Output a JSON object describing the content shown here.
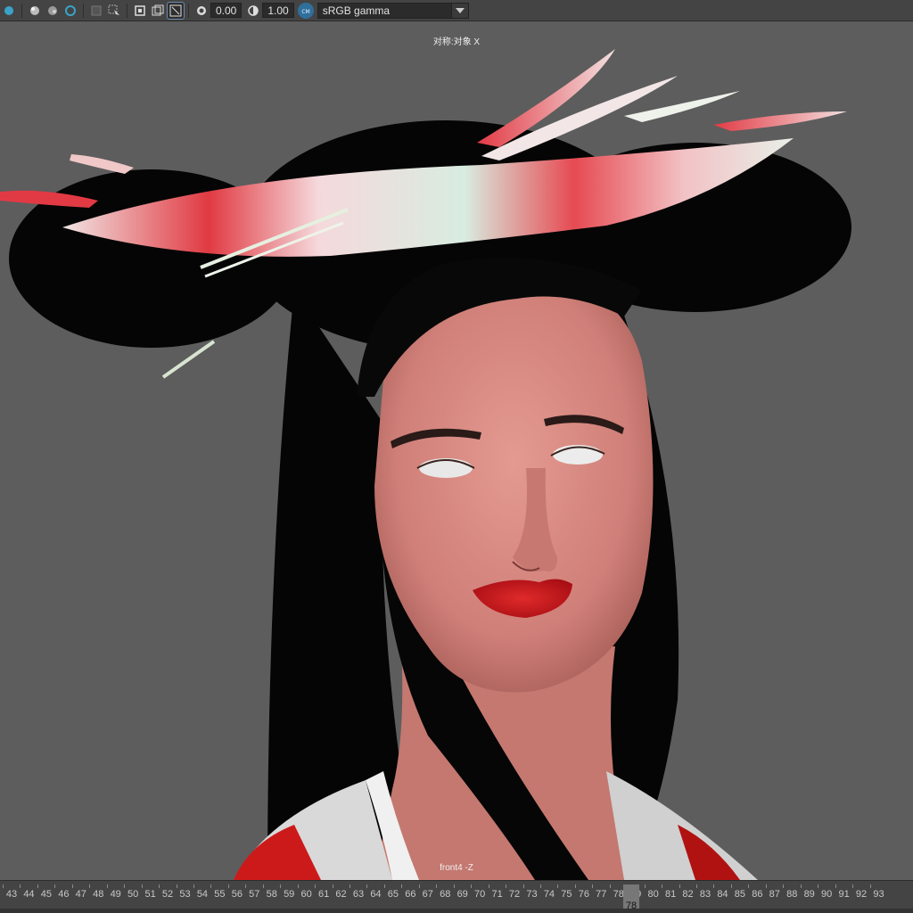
{
  "toolbar": {
    "exposure_value": "0.00",
    "gamma_value": "1.00",
    "color_management_badge": "CM",
    "view_transform": "sRGB gamma"
  },
  "viewport": {
    "symmetry_label": "对称:对象 X",
    "camera_label": "front4 -Z"
  },
  "timeline": {
    "frame_ticks": [
      "43",
      "44",
      "45",
      "46",
      "47",
      "48",
      "49",
      "50",
      "51",
      "52",
      "53",
      "54",
      "55",
      "56",
      "57",
      "58",
      "59",
      "60",
      "61",
      "62",
      "63",
      "64",
      "65",
      "66",
      "67",
      "68",
      "69",
      "70",
      "71",
      "72",
      "73",
      "74",
      "75",
      "76",
      "77",
      "78",
      "79",
      "80",
      "81",
      "82",
      "83",
      "84",
      "85",
      "86",
      "87",
      "88",
      "89",
      "90",
      "91",
      "92",
      "93"
    ],
    "current_frame": "78"
  },
  "colors": {
    "toolbar_bg": "#444444",
    "viewport_bg": "#5d5d5d",
    "accent": "#5b8fc7"
  }
}
